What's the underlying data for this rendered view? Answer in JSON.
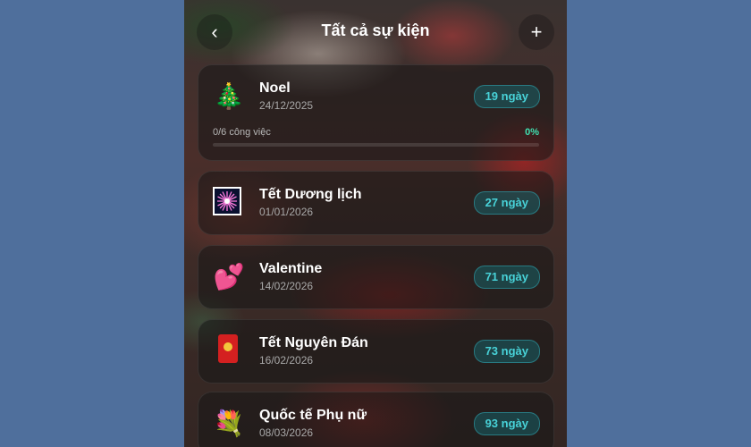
{
  "header": {
    "title": "Tất cả sự kiện",
    "back_icon": "‹",
    "add_icon": "+"
  },
  "events": [
    {
      "emoji": "🎄",
      "name": "Noel",
      "date": "24/12/2025",
      "days": "19 ngày",
      "tasks": "0/6 công việc",
      "progress": "0%"
    },
    {
      "emoji": "",
      "name": "Tết Dương lịch",
      "date": "01/01/2026",
      "days": "27 ngày"
    },
    {
      "emoji": "💕",
      "name": "Valentine",
      "date": "14/02/2026",
      "days": "71 ngày"
    },
    {
      "emoji": "",
      "name": "Tết Nguyên Đán",
      "date": "16/02/2026",
      "days": "73 ngày"
    },
    {
      "emoji": "💐",
      "name": "Quốc tế Phụ nữ",
      "date": "08/03/2026",
      "days": "93 ngày"
    }
  ],
  "colors": {
    "accent": "#48d2d8",
    "progress": "#3fe0b0",
    "frame": "#4f6f9c"
  }
}
